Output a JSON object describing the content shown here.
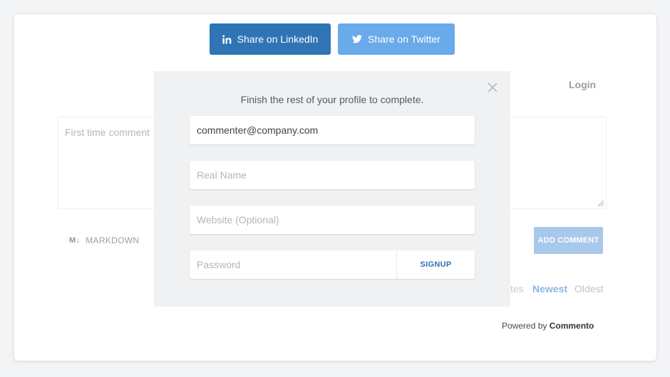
{
  "share": {
    "linkedin_label": "Share on LinkedIn",
    "linkedin_icon": "linkedin-icon",
    "twitter_label": "Share on Twitter",
    "twitter_icon": "twitter-icon",
    "linkedin_color": "#2f74b5",
    "twitter_color": "#69aaea"
  },
  "header": {
    "login_label": "Login"
  },
  "comment": {
    "placeholder": "First time comment",
    "markdown_icon": "M↓",
    "markdown_label": "MARKDOWN",
    "add_button_label": "ADD COMMENT"
  },
  "sort": {
    "votes_partial": "tes",
    "newest": "Newest",
    "oldest": "Oldest"
  },
  "footer": {
    "powered_prefix": "Powered by",
    "powered_brand": "Commento"
  },
  "modal": {
    "message": "Finish the rest of your profile to complete.",
    "email_value": "commenter@company.com",
    "name_placeholder": "Real Name",
    "website_placeholder": "Website (Optional)",
    "password_placeholder": "Password",
    "signup_label": "SIGNUP"
  }
}
